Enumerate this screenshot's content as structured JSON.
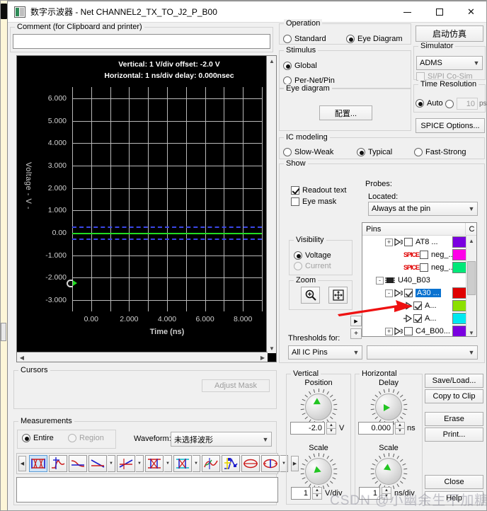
{
  "window": {
    "title": "数字示波器 - Net CHANNEL2_TX_TO_J2_P_B00",
    "icon": "oscilloscope-icon",
    "minimize": "–",
    "maximize": "□",
    "close": "✕"
  },
  "comment": {
    "legend": "Comment (for Clipboard and printer)",
    "value": "",
    "placeholder": ""
  },
  "chart_data": {
    "type": "line",
    "title": "",
    "xlabel": "Time  (ns)",
    "ylabel": "Voltage - V -",
    "xlim": [
      -1.0,
      9.0
    ],
    "ylim": [
      -3.5,
      6.5
    ],
    "xticks": [
      "0.00",
      "2.000",
      "4.000",
      "6.000",
      "8.000"
    ],
    "xtick_values": [
      0,
      2,
      4,
      6,
      8
    ],
    "yticks": [
      "6.000",
      "5.000",
      "4.000",
      "3.000",
      "2.000",
      "1.000",
      "0.00",
      "-1.000",
      "-2.000",
      "-3.000"
    ],
    "ytick_values": [
      6,
      5,
      4,
      3,
      2,
      1,
      0,
      -1,
      -2,
      -3
    ],
    "grid": true,
    "legend_position": "none",
    "readout_line1": "Vertical: 1  V/div  offset:  -2.0 V",
    "readout_line2": "Horizontal: 1 ns/div  delay: 0.000nsec",
    "series": [
      {
        "name": "signal",
        "color": "#22dd22",
        "style": "solid",
        "constant_y": 0.0
      },
      {
        "name": "threshold-high",
        "color": "#3b47e8",
        "style": "dashed",
        "constant_y": 0.27
      },
      {
        "name": "threshold-low",
        "color": "#3b47e8",
        "style": "dashed",
        "constant_y": -0.25
      }
    ]
  },
  "cursors": {
    "legend": "Cursors",
    "adjust_mask": "Adjust Mask"
  },
  "measurements": {
    "legend": "Measurements",
    "entire": "Entire",
    "region": "Region",
    "waveform_label": "Waveform:",
    "waveform_value": "未选择波形",
    "toolbar_icons": [
      "eye-diagram-icon",
      "overshoot-icon",
      "crossing-icon",
      "slope-icon",
      "rise-fall-icon",
      "pulse-width-icon",
      "period-icon",
      "glitch-icon",
      "settle-icon",
      "eye-height-icon",
      "eye-width-icon"
    ]
  },
  "operation": {
    "legend": "Operation",
    "standard": "Standard",
    "eye_diagram": "Eye Diagram",
    "selected": "eye_diagram"
  },
  "stimulus": {
    "legend": "Stimulus",
    "global": "Global",
    "per_net_pin": "Per-Net/Pin",
    "selected": "global"
  },
  "eye_diagram": {
    "legend": "Eye diagram",
    "configure_button": "配置..."
  },
  "ic_modeling": {
    "legend": "IC modeling",
    "slow_weak": "Slow-Weak",
    "typical": "Typical",
    "fast_strong": "Fast-Strong",
    "selected": "typical"
  },
  "show": {
    "legend": "Show",
    "readout_text": "Readout text",
    "readout_text_checked": true,
    "eye_mask": "Eye mask",
    "eye_mask_checked": false
  },
  "probes": {
    "label": "Probes:",
    "located_label": "Located:",
    "located_value": "Always at the pin"
  },
  "pins": {
    "col_name": "Pins",
    "col_color": "C",
    "rows": [
      {
        "indent": 2,
        "expander": "+",
        "icon": "driver-icon",
        "checked": false,
        "name": "AT8 ...",
        "color": "#7a00e0",
        "selected": false
      },
      {
        "indent": 3,
        "expander": "",
        "icon": "spice-icon",
        "checked": false,
        "name": "neg_...",
        "color": "#ff00e8",
        "selected": false
      },
      {
        "indent": 3,
        "expander": "",
        "icon": "spice-icon",
        "checked": false,
        "name": "neg_...",
        "color": "#00e878",
        "selected": false
      },
      {
        "indent": 1,
        "expander": "-",
        "icon": "chip-icon",
        "checked": null,
        "name": "U40_B03",
        "color": "",
        "selected": false
      },
      {
        "indent": 2,
        "expander": "-",
        "icon": "driver-icon",
        "checked": true,
        "name": "A30 ...",
        "color": "#e00000",
        "selected": true
      },
      {
        "indent": 3,
        "expander": "",
        "icon": "receiver-icon",
        "checked": true,
        "name": "A...",
        "color": "#8ce000",
        "selected": false
      },
      {
        "indent": 3,
        "expander": "",
        "icon": "receiver-icon",
        "checked": true,
        "name": "A...",
        "color": "#00e8f0",
        "selected": false
      },
      {
        "indent": 2,
        "expander": "+",
        "icon": "driver-icon",
        "checked": false,
        "name": "C4_B00...",
        "color": "#7a00e0",
        "selected": false
      }
    ]
  },
  "visibility": {
    "legend": "Visibility",
    "voltage": "Voltage",
    "current": "Current",
    "selected": "voltage"
  },
  "zoom": {
    "legend": "Zoom",
    "zoom_in_icon": "magnifier-plus-icon",
    "zoom_fit_icon": "zoom-fit-icon"
  },
  "thresholds": {
    "label": "Thresholds for:",
    "value": "All IC Pins",
    "detail_value": ""
  },
  "simulate": {
    "start_button": "启动仿真"
  },
  "simulator": {
    "legend": "Simulator",
    "value": "ADMS",
    "sipi_cosim": "SI/PI Co-Sim",
    "sipi_checked": false
  },
  "time_resolution": {
    "legend": "Time Resolution",
    "auto": "Auto",
    "manual_value": "10",
    "unit": "ps",
    "selected": "auto"
  },
  "spice_options": {
    "label": "SPICE Options..."
  },
  "vertical": {
    "legend": "Vertical",
    "position_label": "Position",
    "position_value": "-2.0",
    "position_unit": "V",
    "scale_label": "Scale",
    "scale_value": "1",
    "scale_unit": "V/div"
  },
  "horizontal": {
    "legend": "Horizontal",
    "delay_label": "Delay",
    "delay_value": "0.000",
    "delay_unit": "ns",
    "scale_label": "Scale",
    "scale_value": "1",
    "scale_unit": "ns/div"
  },
  "side_buttons": {
    "save_load": "Save/Load...",
    "copy_to_clip": "Copy to Clip",
    "erase": "Erase",
    "print": "Print...",
    "close": "Close",
    "help": "Help"
  },
  "watermark": "CSDN @小幽余生不加糖",
  "colors": {
    "accent_blue": "#0a72d0",
    "trace_green": "#22dd22",
    "threshold_blue": "#3b47e8",
    "annotation_red": "#ee1111",
    "plot_bg": "#000000",
    "window_bg": "#f0f0f0"
  }
}
